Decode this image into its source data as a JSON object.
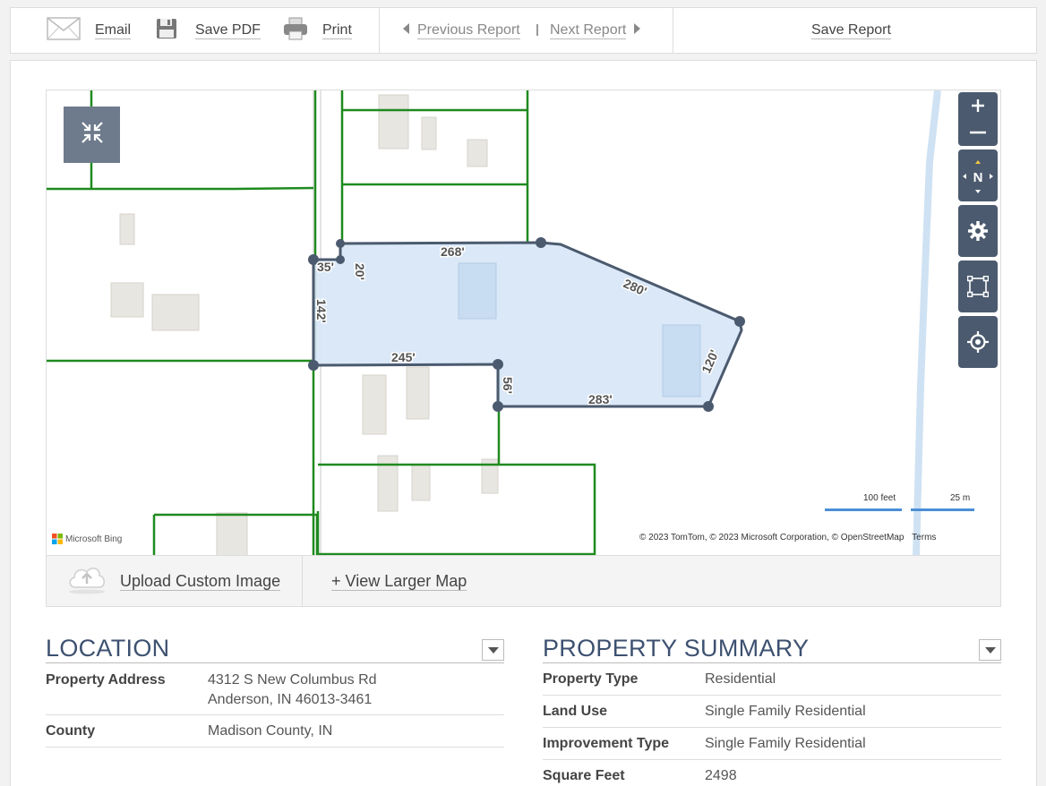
{
  "toolbar": {
    "email": "Email",
    "save_pdf": "Save PDF",
    "print": "Print",
    "previous_report": "Previous Report",
    "next_report": "Next Report",
    "save_report": "Save Report"
  },
  "map": {
    "measurements": [
      "268'",
      "20'",
      "35'",
      "142'",
      "280'",
      "120'",
      "245'",
      "56'",
      "283'"
    ],
    "attribution": "Microsoft Bing",
    "copyright": "© 2023 TomTom, © 2023 Microsoft Corporation, © OpenStreetMap",
    "terms": "Terms",
    "scale_feet": "100 feet",
    "scale_meters": "25 m",
    "compass_label": "N",
    "colors": {
      "parcel_fill": "#d6e6f7",
      "parcel_stroke": "#4b5a6e",
      "lot_lines": "#1f8a1f",
      "water": "#cfe2f3"
    }
  },
  "map_footer": {
    "upload": "Upload Custom Image",
    "view_larger": "+ View Larger Map"
  },
  "location": {
    "title": "LOCATION",
    "rows": [
      {
        "label": "Property Address",
        "value_line1": "4312 S New Columbus Rd",
        "value_line2": "Anderson, IN 46013-3461"
      },
      {
        "label": "County",
        "value": "Madison County, IN"
      }
    ]
  },
  "summary": {
    "title": "PROPERTY SUMMARY",
    "rows": [
      {
        "label": "Property Type",
        "value": "Residential"
      },
      {
        "label": "Land Use",
        "value": "Single Family Residential"
      },
      {
        "label": "Improvement Type",
        "value": "Single Family Residential"
      },
      {
        "label": "Square Feet",
        "value": "2498"
      }
    ]
  }
}
